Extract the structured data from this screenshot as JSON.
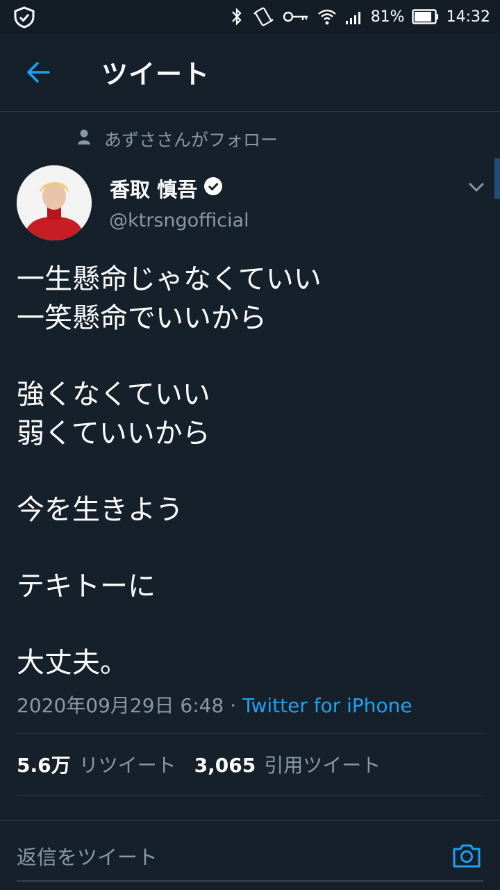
{
  "status_bar": {
    "battery": "81%",
    "time": "14:32",
    "icons": [
      "shield-check-icon",
      "bluetooth-icon",
      "vibrate-icon",
      "vpn-key-icon",
      "wifi-icon",
      "signal-icon",
      "battery-icon"
    ]
  },
  "header": {
    "title": "ツイート",
    "back_icon": "arrow-left-icon"
  },
  "social_context": "あずささんがフォロー",
  "author": {
    "name": "香取 慎吾",
    "handle": "@ktrsngofficial",
    "verified": true
  },
  "tweet": {
    "lines": [
      "一生懸命じゃなくていい",
      "一笑懸命でいいから",
      "",
      "強くなくていい",
      "弱くていいから",
      "",
      "今を生きよう",
      "",
      "テキトーに",
      "",
      "大丈夫。"
    ],
    "timestamp": "2020年09月29日 6:48",
    "separator": " · ",
    "source": "Twitter for iPhone"
  },
  "stats": {
    "retweets_count": "5.6万",
    "retweets_label": "リツイート",
    "quotes_count": "3,065",
    "quotes_label": "引用ツイート"
  },
  "reply": {
    "placeholder": "返信をツイート"
  },
  "colors": {
    "background": "#15202b",
    "accent": "#1da1f2",
    "secondary_text": "#8899a6"
  }
}
